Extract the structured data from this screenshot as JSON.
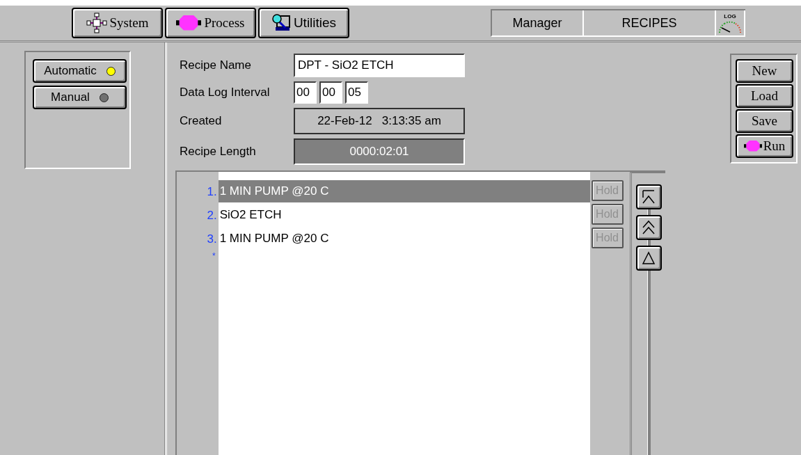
{
  "nav": [
    {
      "label": "System",
      "kind": "system"
    },
    {
      "label": "Process",
      "kind": "process"
    },
    {
      "label": "Utilities",
      "kind": "utilities"
    }
  ],
  "status": {
    "user": "Manager",
    "screen": "RECIPES",
    "log_label": "LOG"
  },
  "modes": [
    {
      "label": "Automatic",
      "selected": true
    },
    {
      "label": "Manual",
      "selected": false
    }
  ],
  "form": {
    "recipe_name_label": "Recipe Name",
    "recipe_name": "DPT - SiO2 ETCH",
    "interval_label": "Data Log Interval",
    "interval": [
      "00",
      "00",
      "05"
    ],
    "created_label": "Created",
    "created": "22-Feb-12   3:13:35 am",
    "length_label": "Recipe Length",
    "length": "0000:02:01"
  },
  "steps": [
    {
      "number": "1.",
      "name": "1 MIN PUMP @20 C",
      "selected": true,
      "hold": "Hold",
      "hold_disabled": true
    },
    {
      "number": "2.",
      "name": "SiO2 ETCH",
      "selected": false,
      "hold": "Hold",
      "hold_disabled": true
    },
    {
      "number": "3.",
      "name": "1 MIN PUMP @20 C",
      "selected": false,
      "hold": "Hold",
      "hold_disabled": true
    }
  ],
  "new_step_marker": "*",
  "scroll_buttons": [
    {
      "kind": "top"
    },
    {
      "kind": "page-up"
    },
    {
      "kind": "up"
    }
  ],
  "actions": [
    {
      "label": "New",
      "kind": "plain"
    },
    {
      "label": "Load",
      "kind": "plain"
    },
    {
      "label": "Save",
      "kind": "plain"
    },
    {
      "label": "Run",
      "kind": "run"
    }
  ]
}
